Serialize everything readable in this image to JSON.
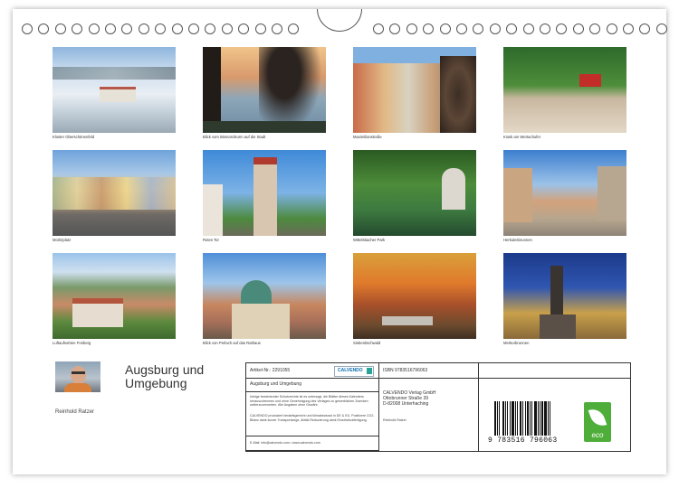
{
  "photos": [
    {
      "caption": "Kloster Oberschönenfeld"
    },
    {
      "caption": "Blick vom Bismarckturm auf die Stadt"
    },
    {
      "caption": "Maximilianstraße"
    },
    {
      "caption": "Kiosk am Wertachufer"
    },
    {
      "caption": "Moritzplatz"
    },
    {
      "caption": "Rotes Tor"
    },
    {
      "caption": "Wittelsbacher Park"
    },
    {
      "caption": "Herkulesbrunnen"
    },
    {
      "caption": "Luftaufnahme Freiberg"
    },
    {
      "caption": "Blick von Perlach auf das Rathaus"
    },
    {
      "caption": "Siebentischwald"
    },
    {
      "caption": "Merkurbrunnen"
    }
  ],
  "footer": {
    "title_line1": "Augsburg und",
    "title_line2": "Umgebung",
    "author": "Reinhold Ratzer",
    "article_no": "Artikel-Nr.: 2291055",
    "calvendo_logo": "CALVENDO",
    "product_title": "Augsburg und Umgebung",
    "legal_text": "Infolge bestehender Schutzrechte ist es untersagt, die Blätter dieses Kalenders herauszutrennen und ohne Genehmigung des Verlages zu gewerblichen Zwecken weiterzuverwerten. Alle Angaben ohne Gewähr.",
    "production_text": "CALVENDO produziert bedarfsgerecht und klimabewusst in DE & EU. Positivere CO2-Bilanz dank kurzer Transportwege, Abfall-Reduzierung dank Einzelstückfertigung.",
    "contact": "E-Mail: info@calvendo.com • www.calvendo.com",
    "isbn": "ISBN 9783516796063",
    "publisher_name": "CALVENDO Verlag GmbH",
    "publisher_street": "Ottobrunner Straße 39",
    "publisher_city": "D-82008 Unterhaching",
    "author_small": "Reinhold Ratzer",
    "barcode_digits": "9 783516 796063",
    "eco_label": "eco"
  }
}
